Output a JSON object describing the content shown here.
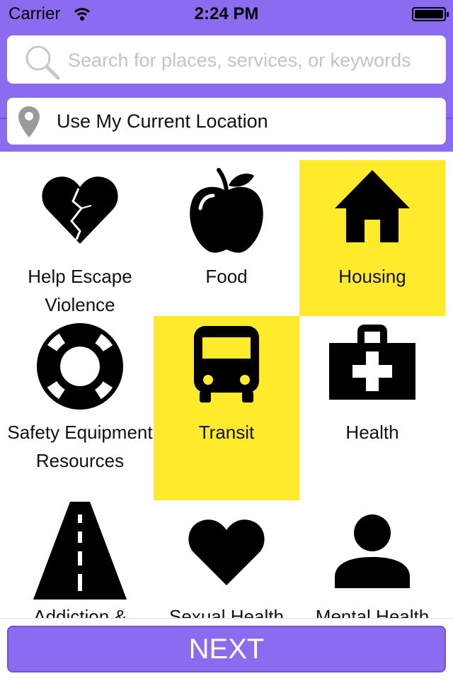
{
  "status_bar": {
    "carrier": "Carrier",
    "time": "2:24 PM"
  },
  "search": {
    "placeholder": "Search for places, services, or keywords"
  },
  "location": {
    "label": "Use My Current Location"
  },
  "categories": [
    {
      "label": "Help Escape Violence",
      "icon": "broken-heart-icon",
      "selected": false
    },
    {
      "label": "Food",
      "icon": "apple-icon",
      "selected": false
    },
    {
      "label": "Housing",
      "icon": "house-icon",
      "selected": true
    },
    {
      "label": "Safety Equipment Resources",
      "icon": "lifebuoy-icon",
      "selected": false
    },
    {
      "label": "Transit",
      "icon": "bus-icon",
      "selected": true
    },
    {
      "label": "Health",
      "icon": "first-aid-kit-icon",
      "selected": false
    },
    {
      "label": "Addiction &",
      "icon": "road-icon",
      "selected": false
    },
    {
      "label": "Sexual Health",
      "icon": "heart-icon",
      "selected": false
    },
    {
      "label": "Mental Health",
      "icon": "person-icon",
      "selected": false
    }
  ],
  "footer": {
    "next_label": "NEXT"
  },
  "colors": {
    "accent": "#8b6cf0",
    "selected": "#ffeb2b"
  }
}
